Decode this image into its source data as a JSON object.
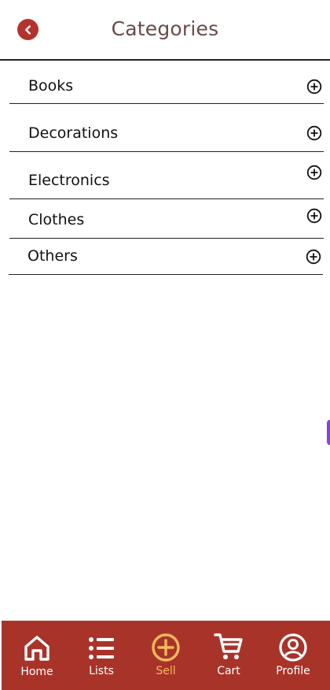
{
  "header": {
    "title": "Categories",
    "back_icon": "chevron-left-icon",
    "back_color": "#b2342c"
  },
  "categories": [
    {
      "label": "Books",
      "icon": "plus-circle-icon"
    },
    {
      "label": "Decorations",
      "icon": "plus-circle-icon"
    },
    {
      "label": "Electronics",
      "icon": "plus-circle-icon"
    },
    {
      "label": "Clothes",
      "icon": "plus-circle-icon"
    },
    {
      "label": "Others",
      "icon": "plus-circle-icon"
    }
  ],
  "nav": {
    "background": "#a83429",
    "active_color": "#f5b95f",
    "items": [
      {
        "label": "Home",
        "icon": "home-icon",
        "active": false
      },
      {
        "label": "Lists",
        "icon": "list-icon",
        "active": false
      },
      {
        "label": "Sell",
        "icon": "plus-circle-icon",
        "active": true
      },
      {
        "label": "Cart",
        "icon": "cart-icon",
        "active": false
      },
      {
        "label": "Profile",
        "icon": "profile-icon",
        "active": false
      }
    ]
  }
}
